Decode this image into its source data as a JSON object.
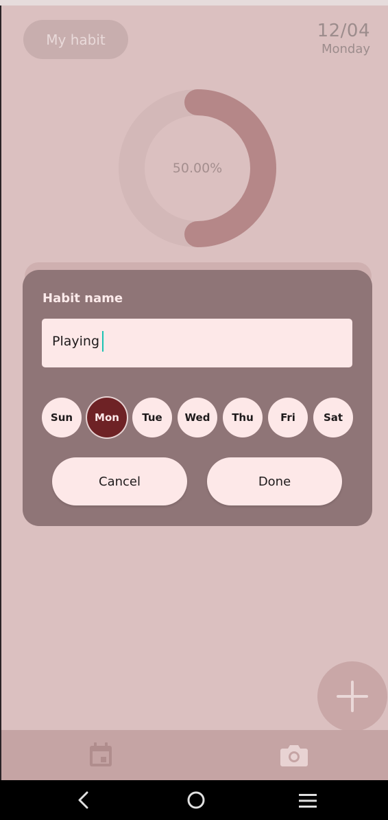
{
  "header": {
    "chip_label": "My habit",
    "date": "12/04",
    "weekday": "Monday"
  },
  "progress": {
    "label": "50.00%",
    "fraction": 0.5,
    "colors": {
      "track": "#d3b8b8",
      "fill": "#b58788"
    }
  },
  "dialog": {
    "title": "Habit name",
    "input_value": "Playing",
    "days": [
      {
        "label": "Sun",
        "selected": false
      },
      {
        "label": "Mon",
        "selected": true
      },
      {
        "label": "Tue",
        "selected": false
      },
      {
        "label": "Wed",
        "selected": false
      },
      {
        "label": "Thu",
        "selected": false
      },
      {
        "label": "Fri",
        "selected": false
      },
      {
        "label": "Sat",
        "selected": false
      }
    ],
    "cancel_label": "Cancel",
    "done_label": "Done"
  },
  "fab": {
    "icon": "plus-icon"
  },
  "bottom_nav": {
    "items": [
      {
        "icon": "calendar-icon"
      },
      {
        "icon": "camera-icon"
      }
    ]
  },
  "system_nav": {
    "items": [
      {
        "icon": "back-icon"
      },
      {
        "icon": "home-icon"
      },
      {
        "icon": "menu-icon"
      }
    ]
  },
  "colors": {
    "background": "#dbc0c0",
    "dialog": "#8f7577",
    "input": "#fde8e8",
    "selected_day": "#6e2225",
    "caret": "#19c2b2"
  }
}
